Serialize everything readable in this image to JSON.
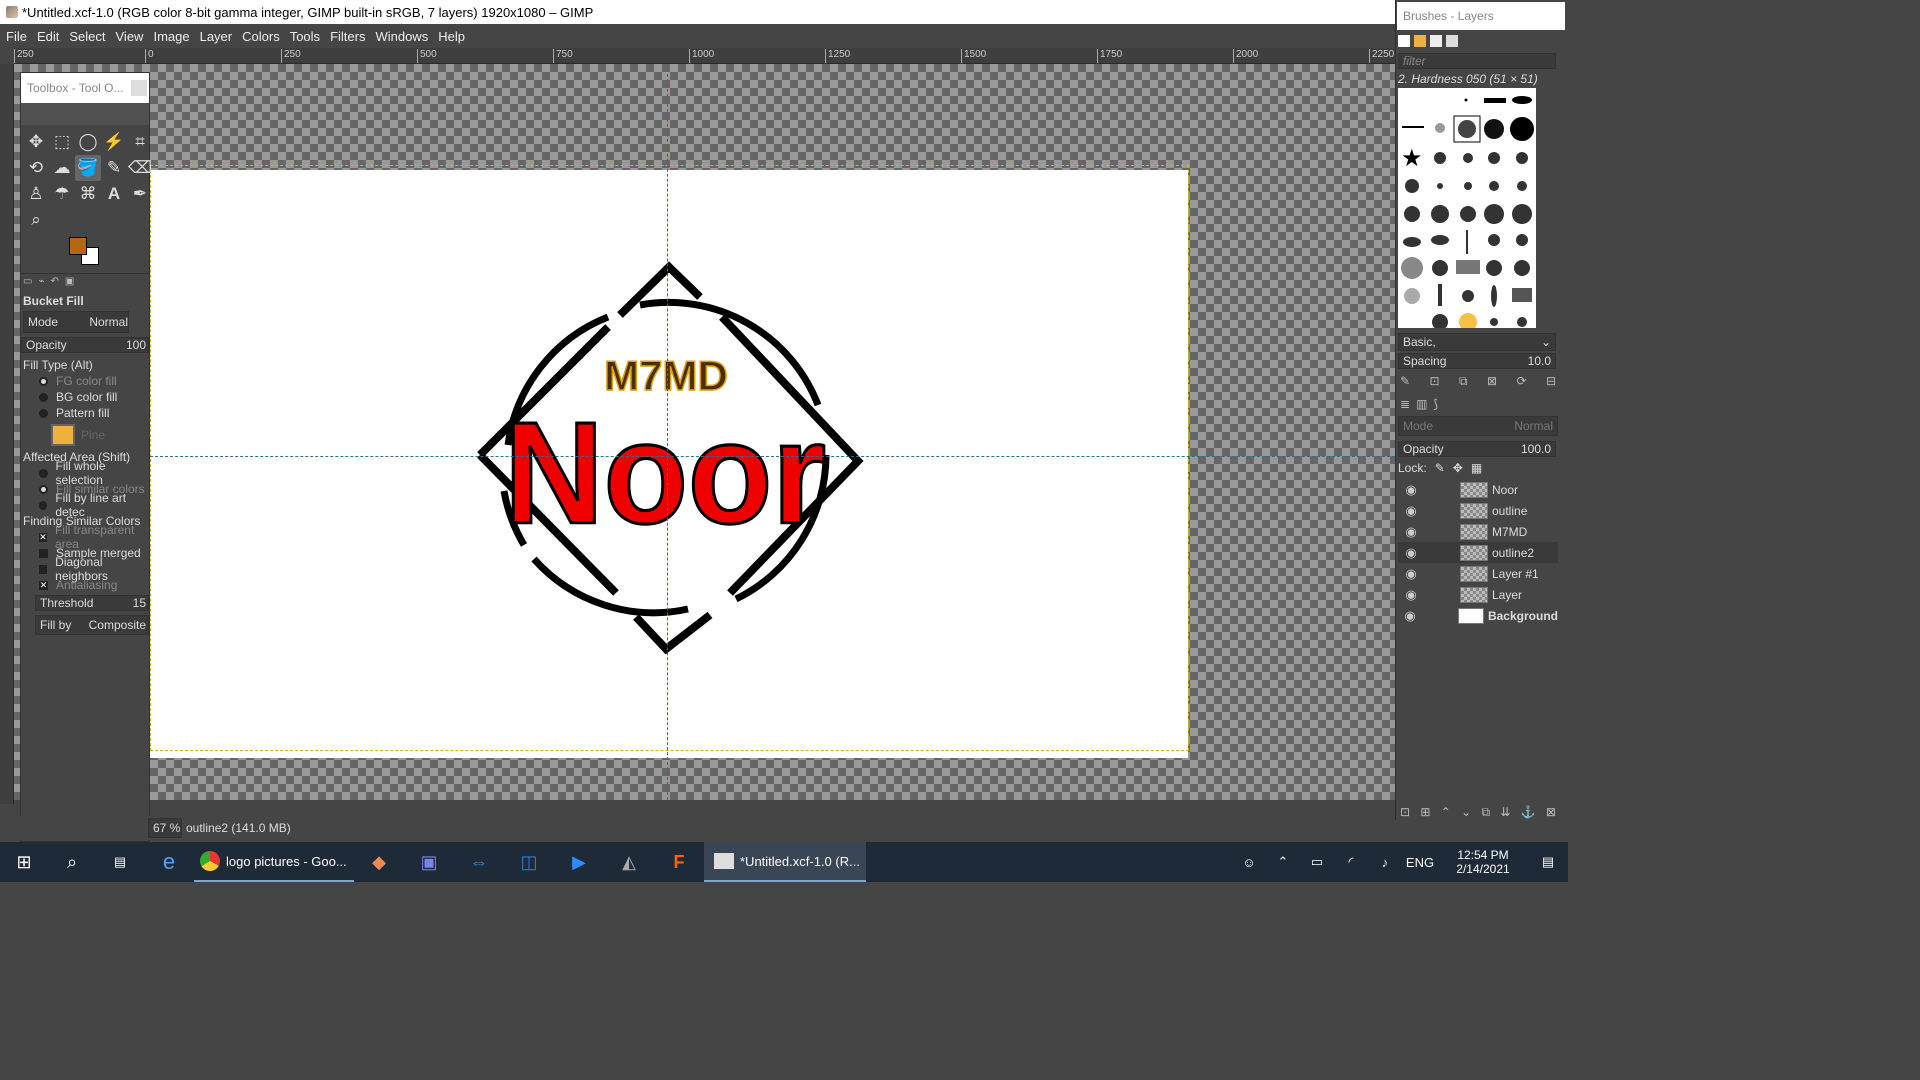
{
  "window": {
    "title": "*Untitled.xcf-1.0 (RGB color 8-bit gamma integer, GIMP built-in sRGB, 7 layers) 1920x1080 – GIMP"
  },
  "menu": [
    "File",
    "Edit",
    "Select",
    "View",
    "Image",
    "Layer",
    "Colors",
    "Tools",
    "Filters",
    "Windows",
    "Help"
  ],
  "ruler": {
    "ticks": [
      "250",
      "0",
      "250",
      "500",
      "750",
      "1000",
      "1250",
      "1500",
      "1750",
      "2000",
      "2250"
    ]
  },
  "toolbox": {
    "title": "Toolbox - Tool O...",
    "tool_name": "Bucket Fill",
    "mode_label": "Mode",
    "mode_value": "Normal",
    "opacity_label": "Opacity",
    "opacity_value": "100",
    "fill_type_label": "Fill Type  (Alt)",
    "fill_type_options": [
      "FG color fill",
      "BG color fill",
      "Pattern fill"
    ],
    "pattern_name": "Pine",
    "affected_area_label": "Affected Area  (Shift)",
    "affected_area_options": [
      "Fill whole selection",
      "Fill similar colors",
      "Fill by line art detec"
    ],
    "finding_label": "Finding Similar Colors",
    "finding_options": [
      "Fill transparent area",
      "Sample merged",
      "Diagonal neighbors",
      "Antialiasing"
    ],
    "threshold_label": "Threshold",
    "threshold_value": "15",
    "fillby_label": "Fill by",
    "fillby_value": "Composite",
    "fg_color": "#b5680f",
    "bg_color": "#ffffff"
  },
  "canvas": {
    "text_small": "M7MD",
    "text_big": "Noor"
  },
  "status": {
    "zoom": "67 %",
    "info": "outline2 (141.0 MB)"
  },
  "brushes": {
    "title": "Brushes - Layers",
    "filter_placeholder": "filter",
    "current_brush": "2. Hardness 050 (51 × 51)",
    "preset": "Basic,",
    "spacing_label": "Spacing",
    "spacing_value": "10.0"
  },
  "layers": {
    "mode_label": "Mode",
    "mode_value": "Normal",
    "opacity_label": "Opacity",
    "opacity_value": "100.0",
    "lock_label": "Lock:",
    "items": [
      "Noor",
      "outline",
      "M7MD",
      "outline2",
      "Layer #1",
      "Layer",
      "Background"
    ]
  },
  "taskbar": {
    "chrome_label": "logo pictures - Goo...",
    "gimp_label": "*Untitled.xcf-1.0 (R...",
    "lang": "ENG",
    "time": "12:54 PM",
    "date": "2/14/2021"
  }
}
